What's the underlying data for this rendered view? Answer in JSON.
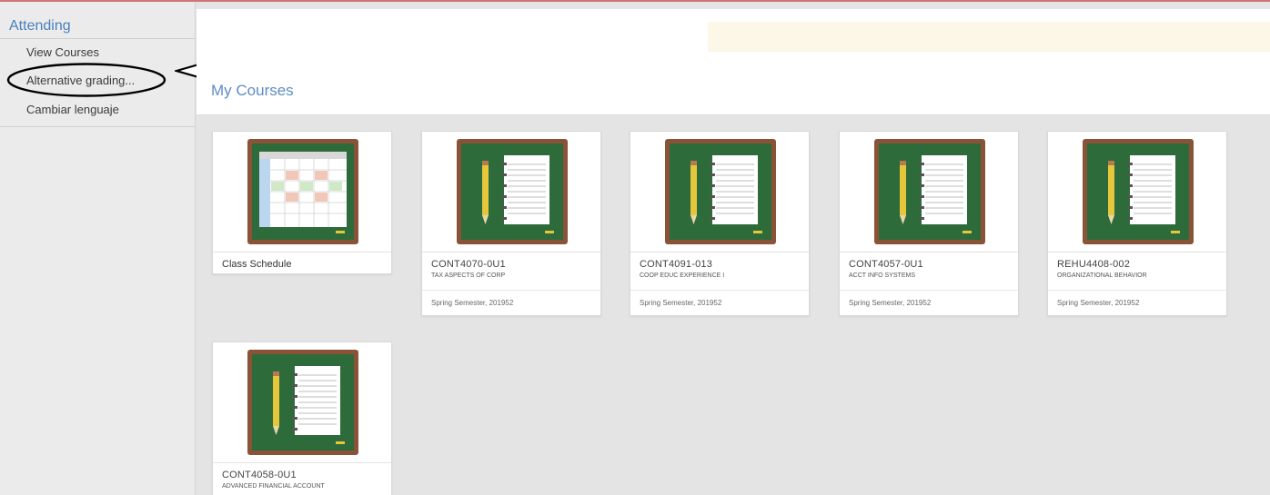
{
  "sidebar": {
    "header": "Attending",
    "items": [
      "View Courses",
      "Alternative grading...",
      "Cambiar lenguaje"
    ]
  },
  "main": {
    "title": "My Courses"
  },
  "schedule_card": {
    "label": "Class Schedule"
  },
  "courses": [
    {
      "code": "CONT4070-0U1",
      "name": "TAX ASPECTS OF CORP",
      "term": "Spring Semester, 201952"
    },
    {
      "code": "CONT4091-013",
      "name": "COOP EDUC EXPERIENCE I",
      "term": "Spring Semester, 201952"
    },
    {
      "code": "CONT4057-0U1",
      "name": "ACCT INFO SYSTEMS",
      "term": "Spring Semester, 201952"
    },
    {
      "code": "REHU4408-002",
      "name": "ORGANIZATIONAL BEHAVIOR",
      "term": "Spring Semester, 201952"
    },
    {
      "code": "CONT4058-0U1",
      "name": "ADVANCED FINANCIAL ACCOUNT",
      "term": ""
    }
  ],
  "icons": {
    "schedule": "calendar-board-icon",
    "course": "notebook-pencil-icon",
    "annotation": "highlight-ellipse-and-arrow"
  },
  "colors": {
    "link_blue": "#4a80bd",
    "board_green": "#2e6b3b",
    "board_frame": "#8a5337",
    "pencil_yellow": "#e6c63a"
  }
}
